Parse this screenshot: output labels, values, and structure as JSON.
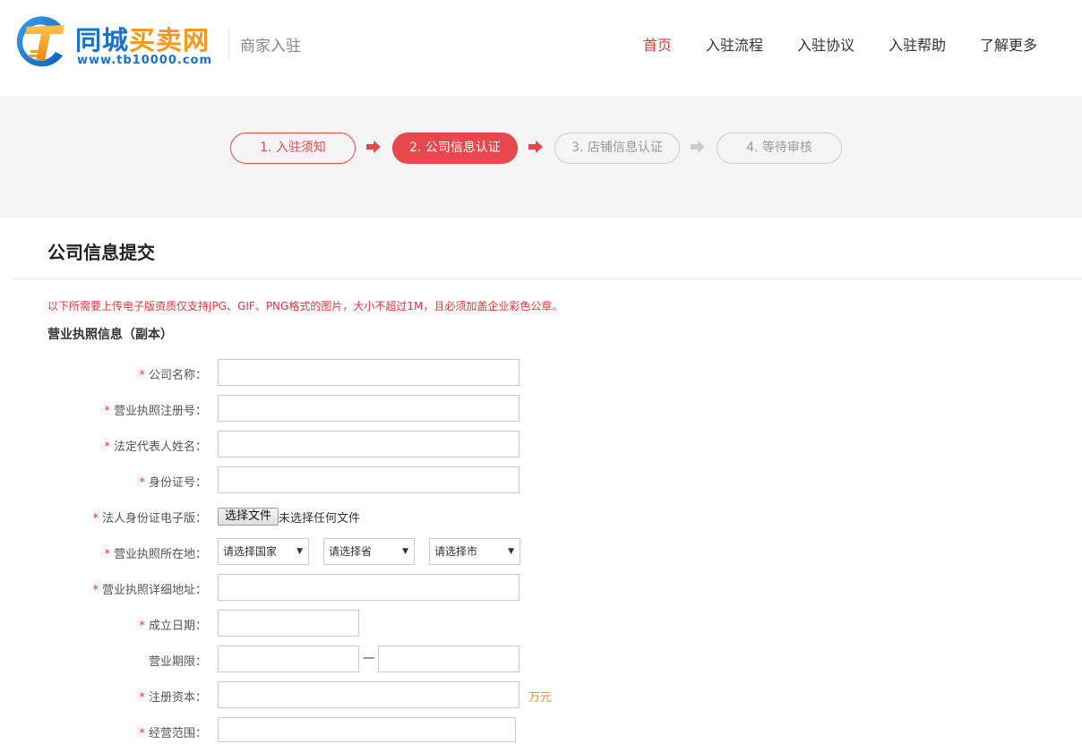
{
  "header": {
    "logo": {
      "title_blue": "同城",
      "title_orange": "买卖网",
      "url": "www.tb10000.com"
    },
    "merchant_title": "商家入驻",
    "nav": [
      {
        "label": "首页",
        "active": true
      },
      {
        "label": "入驻流程",
        "active": false
      },
      {
        "label": "入驻协议",
        "active": false
      },
      {
        "label": "入驻帮助",
        "active": false
      },
      {
        "label": "了解更多",
        "active": false
      }
    ]
  },
  "steps": [
    {
      "label": "1. 入驻须知",
      "state": "done"
    },
    {
      "label": "2. 公司信息认证",
      "state": "current"
    },
    {
      "label": "3. 店铺信息认证",
      "state": "pending"
    },
    {
      "label": "4. 等待审核",
      "state": "pending"
    }
  ],
  "colors": {
    "accent": "#e8474b",
    "brand_blue": "#1a72c9",
    "brand_orange": "#f39a1e",
    "unit": "#e8912b"
  },
  "panel": {
    "title": "公司信息提交",
    "notice": "以下所需要上传电子版资质仅支持JPG、GIF、PNG格式的图片，大小不超过1M，且必须加盖企业彩色公章。",
    "section_title": "营业执照信息（副本）",
    "fields": {
      "company_name": {
        "label": "公司名称：",
        "value": ""
      },
      "reg_no": {
        "label": "营业执照注册号：",
        "value": ""
      },
      "legal_rep": {
        "label": "法定代表人姓名：",
        "value": ""
      },
      "id_no": {
        "label": "身份证号：",
        "value": ""
      },
      "id_file": {
        "label": "法人身份证电子版：",
        "button": "选择文件",
        "status": "未选择任何文件"
      },
      "location": {
        "label": "营业执照所在地：",
        "country": "请选择国家",
        "province": "请选择省",
        "city": "请选择市"
      },
      "address": {
        "label": "营业执照详细地址：",
        "value": ""
      },
      "found_date": {
        "label": "成立日期：",
        "value": ""
      },
      "term": {
        "label": "营业期限：",
        "separator": "—",
        "start": "",
        "end": ""
      },
      "capital": {
        "label": "注册资本：",
        "value": "",
        "unit": "万元"
      },
      "scope": {
        "label": "经营范围：",
        "value": ""
      }
    },
    "required_mark": "*"
  }
}
